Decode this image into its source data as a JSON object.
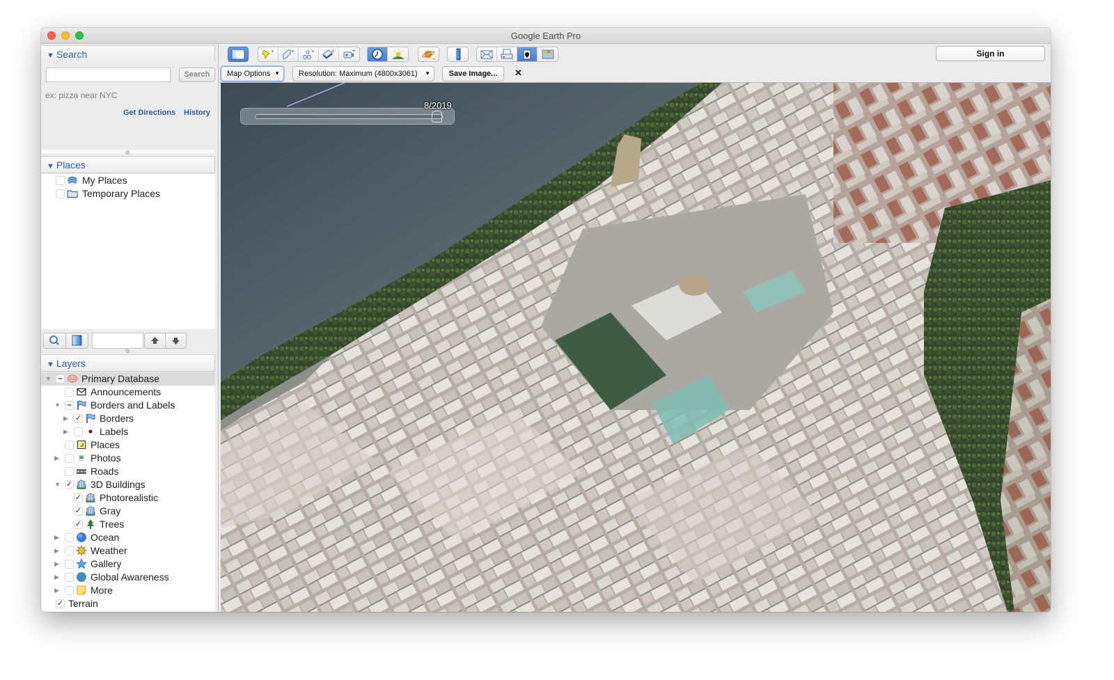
{
  "window": {
    "title": "Google Earth Pro"
  },
  "search": {
    "header": "Search",
    "input_value": "",
    "button_label": "Search",
    "hint": "ex: pizza near NYC",
    "get_directions": "Get Directions",
    "history": "History"
  },
  "places": {
    "header": "Places",
    "items": [
      {
        "label": "My Places",
        "checked": false,
        "icon": "my-places-globe-icon"
      },
      {
        "label": "Temporary Places",
        "checked": false,
        "icon": "folder-icon"
      }
    ],
    "filter_value": ""
  },
  "layers": {
    "header": "Layers",
    "items": [
      {
        "label": "Primary Database",
        "state": "partial",
        "expanded": true,
        "icon": "database-icon",
        "selected": true
      },
      {
        "label": "Announcements",
        "state": "unchecked",
        "icon": "envelope-icon"
      },
      {
        "label": "Borders and Labels",
        "state": "partial",
        "expanded": true,
        "icon": "flag-icon"
      },
      {
        "label": "Borders",
        "state": "checked",
        "expandable": true,
        "icon": "flag-icon"
      },
      {
        "label": "Labels",
        "state": "unchecked",
        "expandable": true,
        "icon": "dot-icon"
      },
      {
        "label": "Places",
        "state": "unchecked",
        "icon": "places-square-icon"
      },
      {
        "label": "Photos",
        "state": "unchecked",
        "expandable": true,
        "icon": "photo-icon"
      },
      {
        "label": "Roads",
        "state": "unchecked",
        "icon": "road-icon"
      },
      {
        "label": "3D Buildings",
        "state": "checked",
        "expanded": true,
        "icon": "building-icon"
      },
      {
        "label": "Photorealistic",
        "state": "checked",
        "icon": "building-icon"
      },
      {
        "label": "Gray",
        "state": "checked",
        "icon": "building-icon"
      },
      {
        "label": "Trees",
        "state": "checked",
        "icon": "tree-icon"
      },
      {
        "label": "Ocean",
        "state": "unchecked",
        "expandable": true,
        "icon": "ocean-globe-icon"
      },
      {
        "label": "Weather",
        "state": "unchecked",
        "expandable": true,
        "icon": "sun-icon"
      },
      {
        "label": "Gallery",
        "state": "unchecked",
        "expandable": true,
        "icon": "star-icon"
      },
      {
        "label": "Global Awareness",
        "state": "unchecked",
        "expandable": true,
        "icon": "earth-icon"
      },
      {
        "label": "More",
        "state": "unchecked",
        "expandable": true,
        "icon": "note-icon"
      },
      {
        "label": "Terrain",
        "state": "checked",
        "icon": ""
      }
    ]
  },
  "toolbar": {
    "buttons": [
      {
        "name": "sidebar-toggle",
        "active": true
      },
      {
        "name": "add-placemark"
      },
      {
        "name": "add-polygon"
      },
      {
        "name": "add-path"
      },
      {
        "name": "add-image-overlay"
      },
      {
        "name": "record-tour"
      },
      {
        "name": "historical-imagery",
        "active": true
      },
      {
        "name": "sunlight"
      },
      {
        "name": "switch-planet"
      },
      {
        "name": "ruler"
      },
      {
        "name": "email"
      },
      {
        "name": "print"
      },
      {
        "name": "save-image",
        "active": true
      },
      {
        "name": "view-in-maps"
      }
    ],
    "sign_in": "Sign in",
    "map_options": "Map Options",
    "resolution": "Resolution: Maximum (4800x3061)",
    "save_image": "Save Image...",
    "close": "✕"
  },
  "map": {
    "time_slider_label": "8/2019",
    "time_slider_position": 1.0
  },
  "colors": {
    "accent_blue": "#2d5fa5",
    "active_button": "#5a8dd4",
    "water": "#4c5962",
    "trees": "#3a4f2c"
  }
}
